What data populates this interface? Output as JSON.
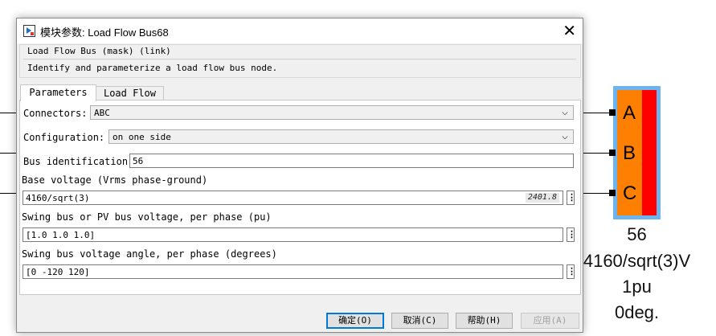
{
  "dialog": {
    "title": "模块参数: Load Flow Bus68",
    "mask_line": "Load Flow Bus (mask) (link)",
    "description": "Identify and parameterize a load flow bus node.",
    "tabs": [
      "Parameters",
      "Load Flow"
    ],
    "connectors_label": "Connectors:",
    "connectors_value": "ABC",
    "configuration_label": "Configuration:",
    "configuration_value": "on one side",
    "bus_id_label": "Bus identification",
    "bus_id_value": "56",
    "base_voltage_label": "Base voltage (Vrms phase-ground)",
    "base_voltage_value": "4160/sqrt(3)",
    "base_voltage_eval": "2401.8",
    "swing_voltage_label": "Swing bus or PV bus voltage, per phase (pu)",
    "swing_voltage_value": "[1.0 1.0 1.0]",
    "swing_angle_label": "Swing bus voltage angle, per phase (degrees)",
    "swing_angle_value": "[0 -120 120]",
    "buttons": {
      "ok": "确定(O)",
      "cancel": "取消(C)",
      "help": "帮助(H)",
      "apply": "应用(A)"
    }
  },
  "block": {
    "ports": [
      "A",
      "B",
      "C"
    ],
    "annotations": [
      "56",
      "4160/sqrt(3)V",
      "1pu",
      "0deg."
    ]
  },
  "icons": {
    "app": "simulink-app-icon",
    "close": "close-icon",
    "dropdown": "chevron-down-icon",
    "more": "kebab-menu-icon"
  },
  "colors": {
    "block_fill": "#ff7f00",
    "block_accent": "#ff0000",
    "selection": "#6cb4f0",
    "default_button_border": "#0078d7"
  }
}
